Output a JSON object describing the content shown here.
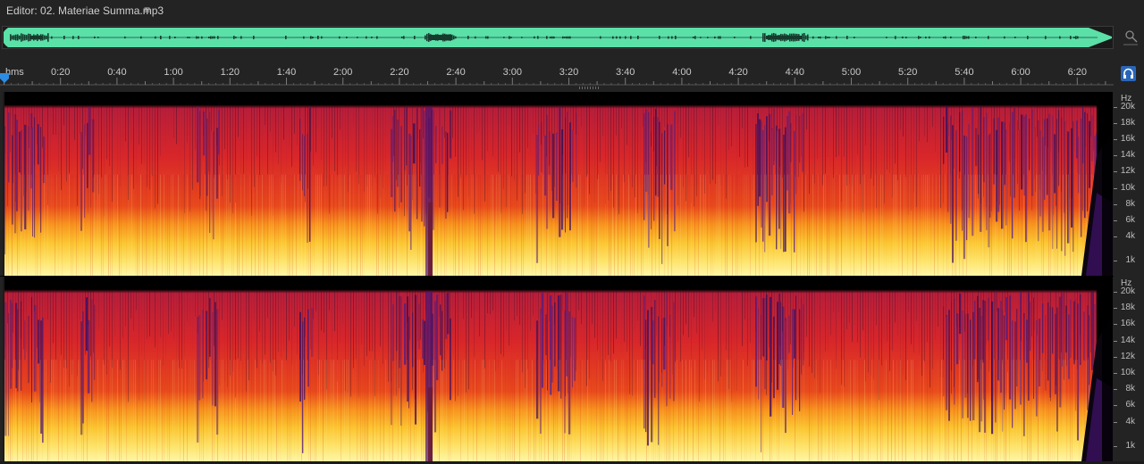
{
  "editor": {
    "title": "Editor: 02. Materiae Summa.mp3",
    "menu_icon": "hamburger-menu-icon"
  },
  "colors": {
    "waveform": "#5be0a8",
    "background": "#232323",
    "accent": "#2a66b8",
    "spectrum_low": "#ffe96a",
    "spectrum_mid": "#f04a1e",
    "spectrum_high": "#5a1d7a"
  },
  "timeline": {
    "unit_label": "hms",
    "ticks": [
      "0:20",
      "0:40",
      "1:00",
      "1:20",
      "1:40",
      "2:00",
      "2:20",
      "2:40",
      "3:00",
      "3:20",
      "3:40",
      "4:00",
      "4:20",
      "4:40",
      "5:00",
      "5:20",
      "5:40",
      "6:00",
      "6:20"
    ]
  },
  "overview": {
    "icon": "zoom-navigator-icon"
  },
  "monitor": {
    "icon": "headphones-icon"
  },
  "channels": [
    {
      "name": "channel-1",
      "hz_label": "Hz",
      "freq_labels": [
        "20k",
        "18k",
        "16k",
        "14k",
        "12k",
        "10k",
        "8k",
        "6k",
        "4k",
        "1k"
      ]
    },
    {
      "name": "channel-2",
      "hz_label": "Hz",
      "freq_labels": [
        "20k",
        "18k",
        "16k",
        "14k",
        "12k",
        "10k",
        "8k",
        "6k",
        "4k",
        "1k"
      ]
    }
  ]
}
